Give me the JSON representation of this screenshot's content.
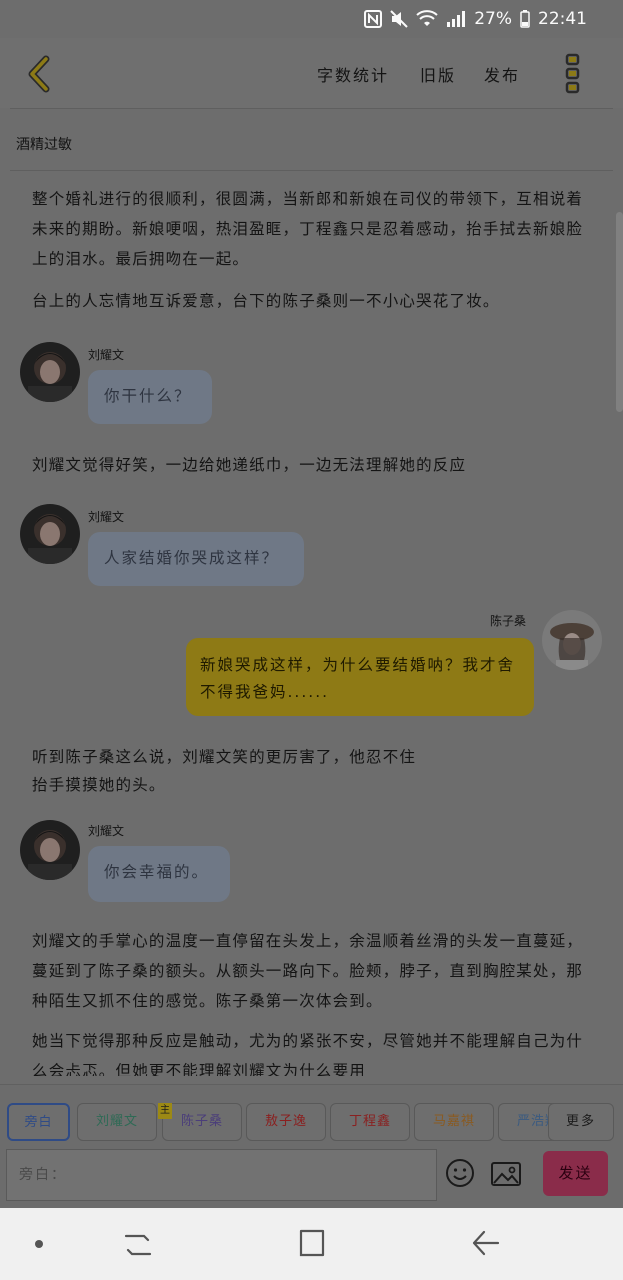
{
  "status_bar": {
    "battery": "27%",
    "time": "22:41"
  },
  "header": {
    "word_count_label": "字数统计",
    "old_version_label": "旧版",
    "publish_label": "发布"
  },
  "chapter_title": "酒精过敏",
  "content": {
    "p1": "整个婚礼进行的很顺利，很圆满，当新郎和新娘在司仪的带领下，互相说着未来的期盼。新娘哽咽，热泪盈眶，丁程鑫只是忍着感动，抬手拭去新娘脸上的泪水。最后拥吻在一起。",
    "p2": "台上的人忘情地互诉爱意，台下的陈子桑则一不小心哭花了妆。",
    "msg1": {
      "speaker": "刘耀文",
      "text": "你干什么？"
    },
    "p3": "刘耀文觉得好笑，一边给她递纸巾，一边无法理解她的反应",
    "msg2": {
      "speaker": "刘耀文",
      "text": "人家结婚你哭成这样？"
    },
    "msg3": {
      "speaker": "陈子桑",
      "text": "新娘哭成这样，为什么要结婚呐？我才舍不得我爸妈......"
    },
    "p4_line1": "听到陈子桑这么说，刘耀文笑的更厉害了，他忍不住",
    "p4_line2": "抬手摸摸她的头。",
    "msg4": {
      "speaker": "刘耀文",
      "text": "你会幸福的。"
    },
    "p5": "刘耀文的手掌心的温度一直停留在头发上，余温顺着丝滑的头发一直蔓延，蔓延到了陈子桑的额头。从额头一路向下。脸颊，脖子，直到胸腔某处，那种陌生又抓不住的感觉。陈子桑第一次体会到。",
    "p6": "她当下觉得那种反应是触动，尤为的紧张不安，尽管她并不能理解自己为什么会忐忑。但她更不能理解刘耀文为什么要用"
  },
  "roles": {
    "main_mark": "主",
    "chips": [
      {
        "label": "旁白",
        "color": "#2f4b86"
      },
      {
        "label": "刘耀文",
        "color": "#2e6a55"
      },
      {
        "label": "陈子桑",
        "color": "#4b3e7a"
      },
      {
        "label": "敖子逸",
        "color": "#8a2020"
      },
      {
        "label": "丁程鑫",
        "color": "#8a2020"
      },
      {
        "label": "马嘉祺",
        "color": "#8a5a20"
      },
      {
        "label": "严浩翔",
        "color": "#3a5a80"
      }
    ],
    "more_label": "更多"
  },
  "composer": {
    "placeholder": "旁白：",
    "send_label": "发送"
  }
}
